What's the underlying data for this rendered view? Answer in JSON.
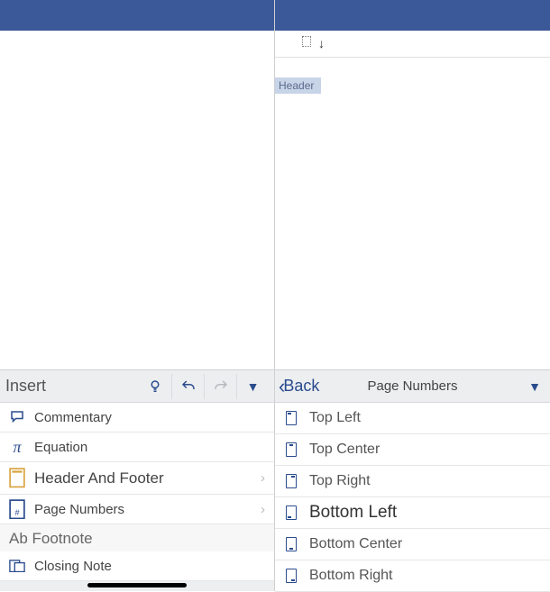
{
  "header_label": "Header",
  "left_panel": {
    "title": "Insert",
    "items": [
      {
        "label": "Commentary"
      },
      {
        "label": "Equation"
      },
      {
        "label": "Header And Footer",
        "has_sub": true
      },
      {
        "label": "Page Numbers",
        "has_sub": true
      }
    ],
    "section": "Ab Footnote",
    "closing": "Closing Note"
  },
  "right_panel": {
    "back": "Back",
    "title": "Page Numbers",
    "positions": [
      {
        "label": "Top Left"
      },
      {
        "label": "Top Center"
      },
      {
        "label": "Top Right"
      },
      {
        "label": "Bottom Left",
        "selected": true
      },
      {
        "label": "Bottom Center"
      },
      {
        "label": "Bottom Right"
      }
    ]
  }
}
